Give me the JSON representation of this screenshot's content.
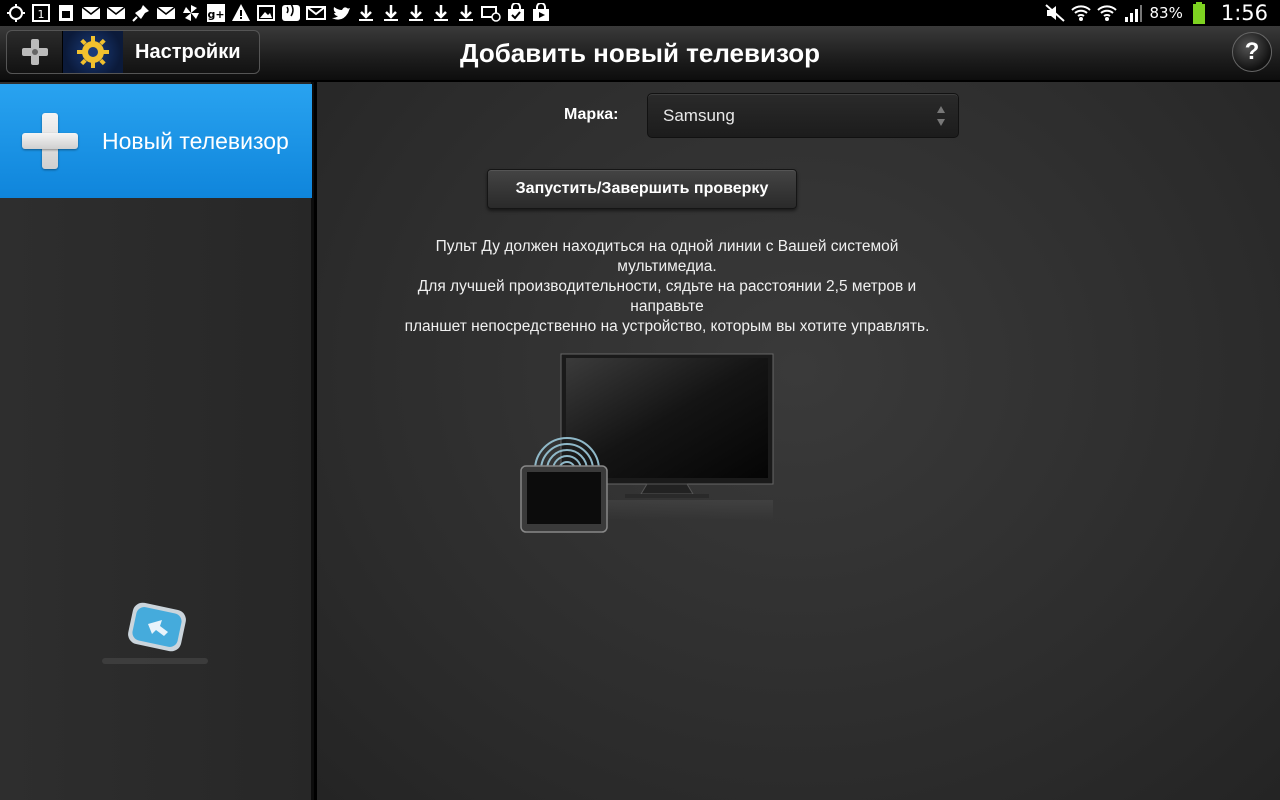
{
  "status_bar": {
    "notifications": [
      "location-icon",
      "calendar-icon",
      "sim-icon",
      "mail-icon",
      "mail-icon",
      "pin-icon",
      "mail-icon",
      "pinwheel-icon",
      "gplus-icon",
      "warning-icon",
      "image-icon",
      "voicemail-icon",
      "gmail-icon",
      "twitter-icon",
      "download-icon",
      "download-icon",
      "download-icon",
      "download-icon",
      "download-icon",
      "mail-sync-icon",
      "bag-icon",
      "play-store-icon"
    ],
    "battery_percent": "83%",
    "clock": "1:56"
  },
  "action_bar": {
    "app_title": "Настройки",
    "page_title": "Добавить новый телевизор",
    "help_label": "?"
  },
  "sidebar": {
    "items": [
      {
        "label": "Новый телевизор"
      }
    ]
  },
  "main": {
    "brand_label": "Марка:",
    "brand_value": "Samsung",
    "start_button_label": "Запустить/Завершить проверку",
    "instructions": [
      "Пульт Ду должен находиться на одной линии с Вашей системой",
      "мультимедиа.",
      "Для лучшей производительности, сядьте на расстоянии 2,5 метров и",
      "направьте",
      "планшет непосредственно на устройство, которым вы хотите управлять."
    ]
  },
  "colors": {
    "accent": "#1a92e4",
    "background": "#2e2e2e",
    "text": "#ffffff"
  }
}
